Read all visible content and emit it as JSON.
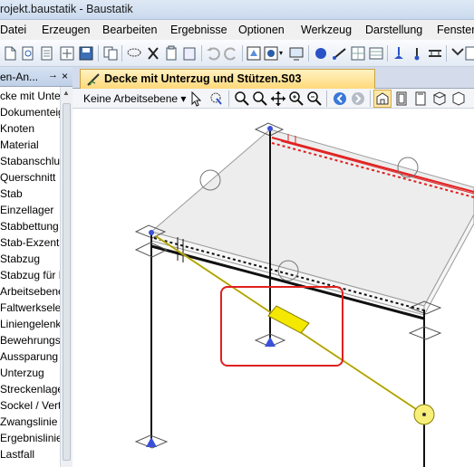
{
  "window": {
    "title": "rojekt.baustatik - Baustatik"
  },
  "menu": [
    "Datei",
    "Erzeugen",
    "Bearbeiten",
    "Ergebnisse",
    "Optionen",
    "Werkzeug",
    "Darstellung",
    "Fenster"
  ],
  "panel": {
    "title": "en-An...",
    "pin": "→",
    "close": "×",
    "items": [
      "cke mit Unter",
      "Dokumenteig",
      "Knoten",
      "Material",
      "Stabanschlus",
      "Querschnitt",
      "Stab",
      "Einzellager",
      "Stabbettung",
      "Stab-Exzentri",
      "Stabzug",
      "Stabzug für E",
      "Arbeitsebene",
      "Faltwerkselen",
      "Liniengelenk",
      "Bewehrungsa",
      "Aussparung",
      "Unterzug",
      "Streckenlage",
      "Sockel / Vert",
      "Zwangslinie",
      "Ergebnislinie",
      "Lastfall",
      ""
    ]
  },
  "document_tab": {
    "label": "Decke mit Unterzug und Stützen.S03"
  },
  "view_toolbar": {
    "work_plane_label": "Keine Arbeitsebene ▾"
  },
  "colors": {
    "accent_tab": "#ffd97a",
    "selection": "#e02020",
    "beam_red": "#e02020",
    "load_yellow": "#f5e800"
  }
}
